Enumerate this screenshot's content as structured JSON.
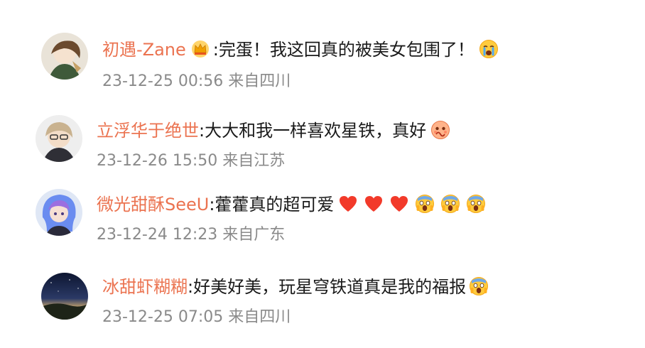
{
  "comments": [
    {
      "username": "初遇-Zane",
      "text": ":完蛋！我这回真的被美女包围了！",
      "timestamp": "23-12-25 00:56",
      "location": "来自四川",
      "badge_icon": "crown-badge-icon",
      "emojis": [
        "crying-face-icon"
      ]
    },
    {
      "username": "立浮华于绝世",
      "text": ":大大和我一样喜欢星铁，真好",
      "timestamp": "23-12-26 15:50",
      "location": "来自江苏",
      "emojis": [
        "blushing-face-icon"
      ]
    },
    {
      "username": "微光甜酥SeeU",
      "text": ":藿藿真的超可爱",
      "timestamp": "23-12-24 12:23",
      "location": "来自广东",
      "emojis": [
        "heart-icon",
        "heart-icon",
        "heart-icon",
        "screaming-face-icon",
        "screaming-face-icon",
        "screaming-face-icon"
      ]
    },
    {
      "username": "冰甜虾糊糊",
      "text": ":好美好美，玩星穹铁道真是我的福报",
      "timestamp": "23-12-25 07:05",
      "location": "来自四川",
      "emojis": [
        "screaming-face-icon"
      ]
    }
  ],
  "colors": {
    "username": "#eb7350",
    "text": "#1a1a1a",
    "meta": "#8a8a8a"
  }
}
